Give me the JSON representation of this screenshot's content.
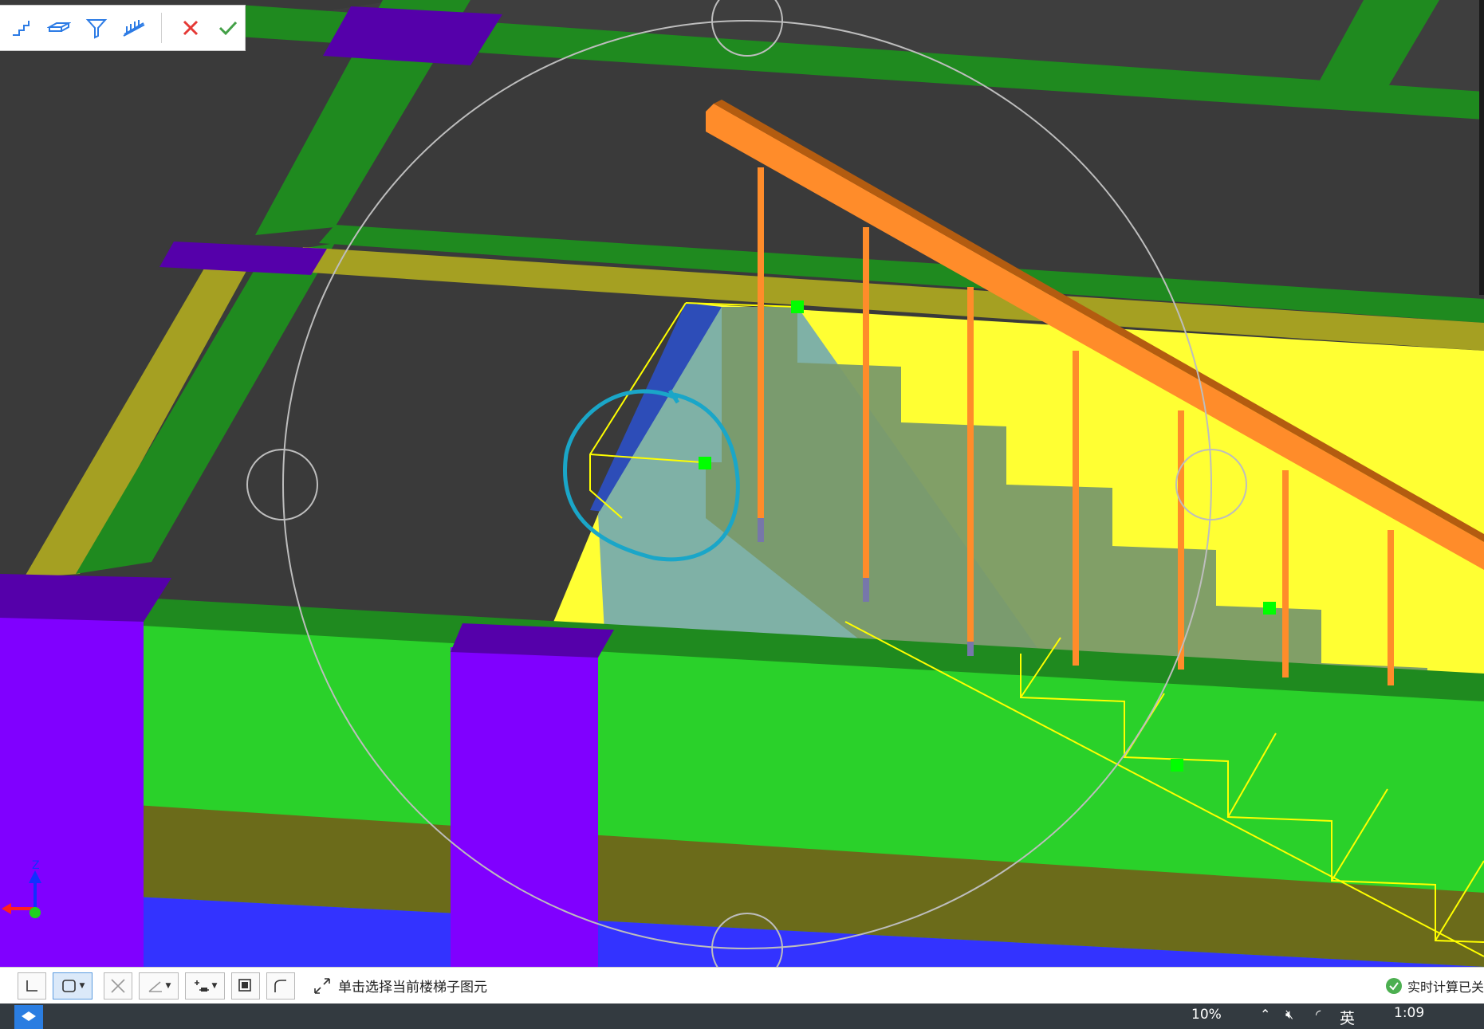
{
  "toolbar": {
    "buttons": [
      {
        "name": "stair-icon",
        "label": ""
      },
      {
        "name": "slab-icon",
        "label": ""
      },
      {
        "name": "funnel-beam-icon",
        "label": ""
      },
      {
        "name": "railing-icon",
        "label": ""
      }
    ],
    "cancel_icon": "close-icon",
    "confirm_icon": "check-icon",
    "colors": {
      "icon": "#2c7be5",
      "cancel": "#e53935",
      "confirm": "#43a047"
    }
  },
  "statusbar": {
    "hint_text": "单击选择当前楼梯子图元",
    "calc_status": "实时计算已关",
    "tools": [
      "ortho-icon",
      "select-box-icon",
      "cross-icon",
      "angle-icon",
      "offset-icon",
      "snap-icon",
      "arc-icon"
    ]
  },
  "taskbar": {
    "percent": "10%",
    "ime": "英",
    "time": "1:09"
  },
  "scene_colors": {
    "background": "#3a3a3a",
    "beam": "#1f8a1f",
    "wall_green": "#2ad12a",
    "column": "#8000ff",
    "floor_yellow": "#ffff33",
    "stair_steps": "#7a9a6a",
    "railing": "#ff8c2a",
    "grip": "#00ff00",
    "annotation_circle": "#1aa6c8"
  }
}
